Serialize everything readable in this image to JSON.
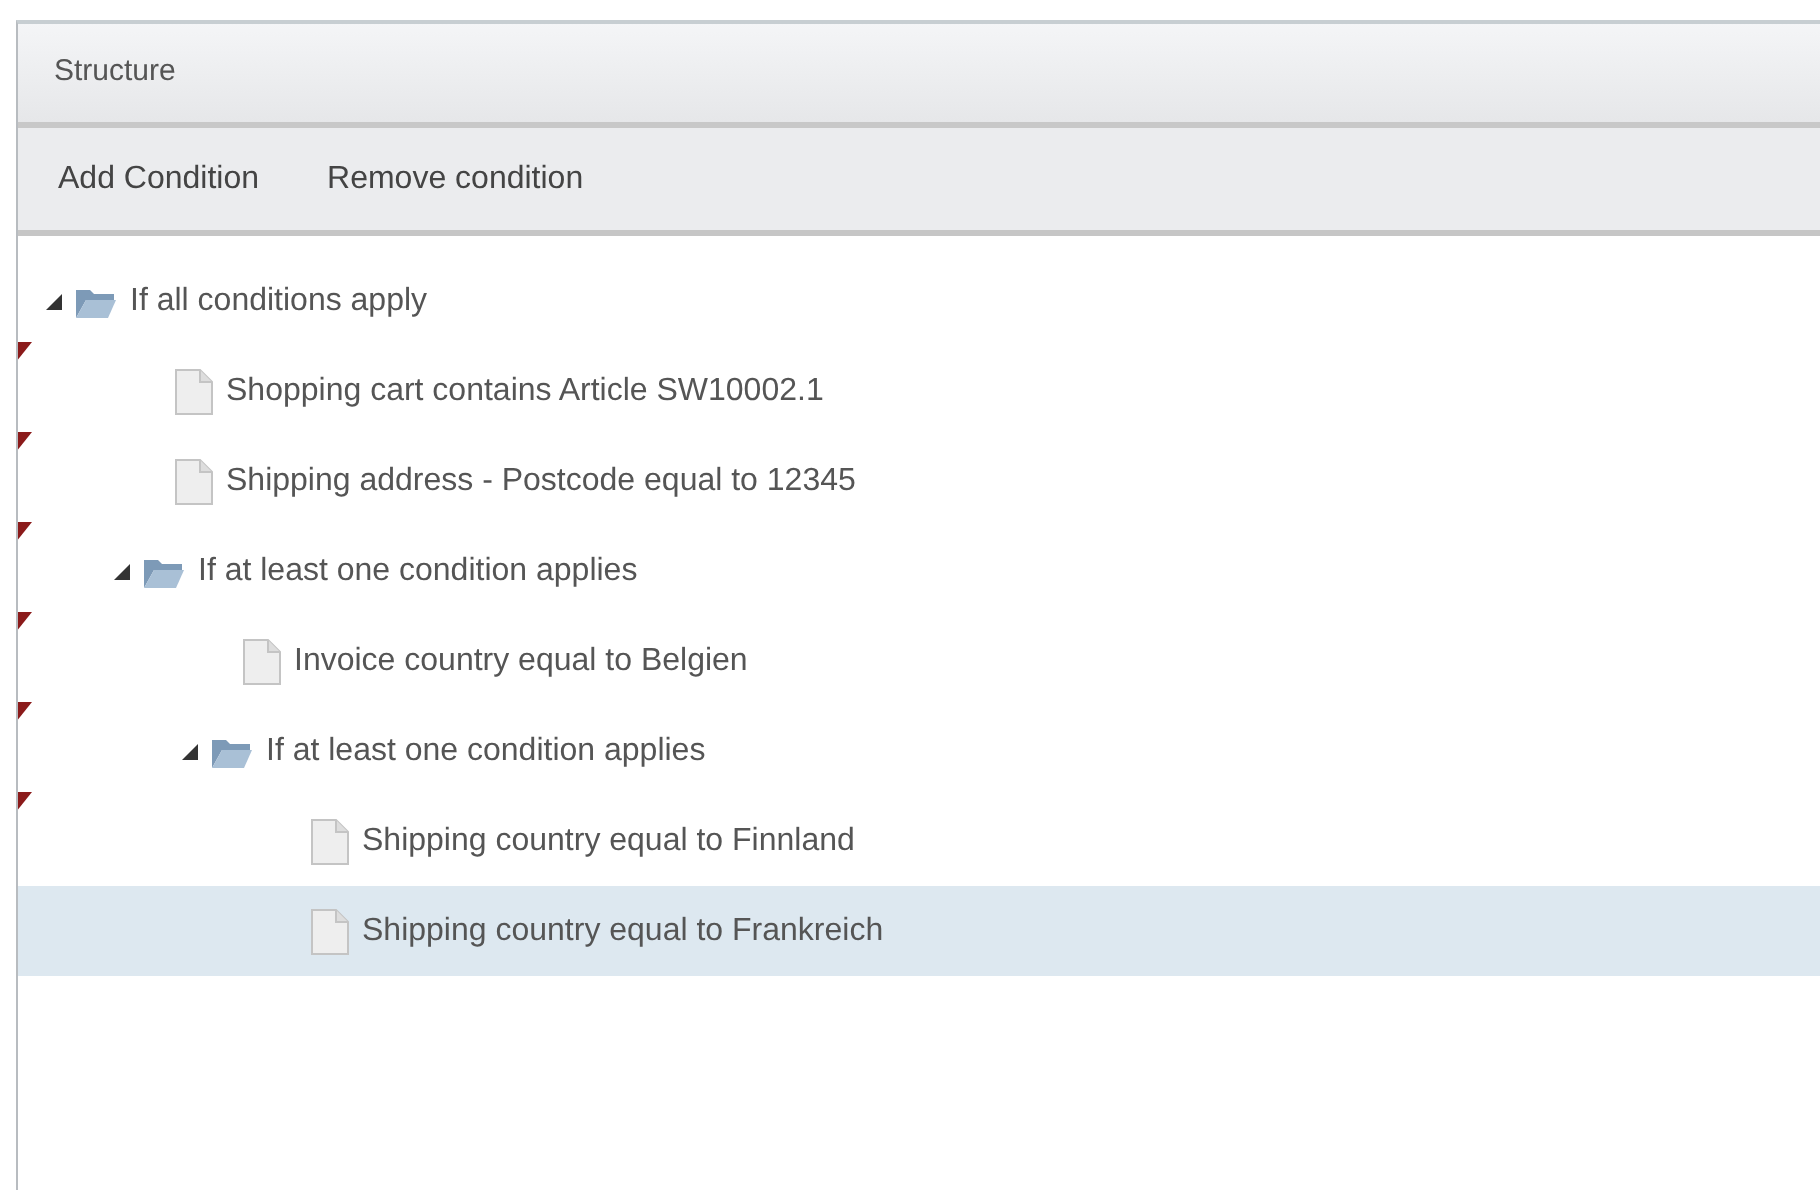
{
  "panel": {
    "title": "Structure"
  },
  "toolbar": [
    "Add Condition",
    "Remove condition"
  ],
  "tree": [
    {
      "kind": "folder",
      "label": "If all conditions apply",
      "expanded": true,
      "selected": false,
      "modified": false,
      "children": [
        {
          "kind": "condition",
          "label": "Shopping cart contains Article SW10002.1",
          "selected": false,
          "modified": true
        },
        {
          "kind": "condition",
          "label": "Shipping address - Postcode equal to 12345",
          "selected": false,
          "modified": true
        },
        {
          "kind": "folder",
          "label": "If at least one condition applies",
          "expanded": true,
          "selected": false,
          "modified": true,
          "children": [
            {
              "kind": "condition",
              "label": "Invoice country equal to Belgien",
              "selected": false,
              "modified": true
            },
            {
              "kind": "folder",
              "label": "If at least one condition applies",
              "expanded": true,
              "selected": false,
              "modified": true,
              "children": [
                {
                  "kind": "condition",
                  "label": "Shipping country equal to Finnland",
                  "selected": false,
                  "modified": true
                },
                {
                  "kind": "condition",
                  "label": "Shipping country equal to Frankreich",
                  "selected": true,
                  "modified": false
                }
              ]
            }
          ]
        }
      ]
    }
  ]
}
